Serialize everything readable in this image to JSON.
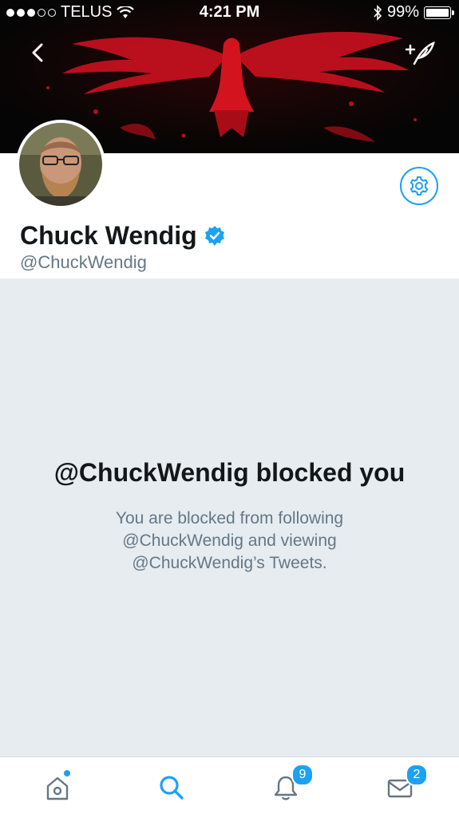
{
  "status_bar": {
    "carrier": "TELUS",
    "time": "4:21 PM",
    "battery": "99%",
    "battery_level": 0.99,
    "signal_dots_filled": 3,
    "signal_dots_total": 5
  },
  "header": {
    "back_icon": "chevron-left-icon",
    "compose_icon": "compose-tweet-icon",
    "banner": "red-phoenix-banner"
  },
  "profile": {
    "name": "Chuck Wendig",
    "handle": "@ChuckWendig",
    "verified": true,
    "settings_icon": "gear-icon"
  },
  "blocked": {
    "title": "@ChuckWendig blocked you",
    "line1": "You are blocked from following",
    "line2": "@ChuckWendig and viewing",
    "line3": "@ChuckWendig’s Tweets."
  },
  "tabs": [
    {
      "name": "home",
      "icon": "home-icon",
      "unread_dot": true
    },
    {
      "name": "search",
      "icon": "search-icon",
      "active": true
    },
    {
      "name": "notifications",
      "icon": "bell-icon",
      "badge": "9"
    },
    {
      "name": "messages",
      "icon": "mail-icon",
      "badge": "2"
    }
  ],
  "colors": {
    "accent": "#1da1f2",
    "background": "#e6ecf0",
    "banner_red": "#c8101e",
    "text_primary": "#14171a",
    "text_secondary": "#657786"
  }
}
